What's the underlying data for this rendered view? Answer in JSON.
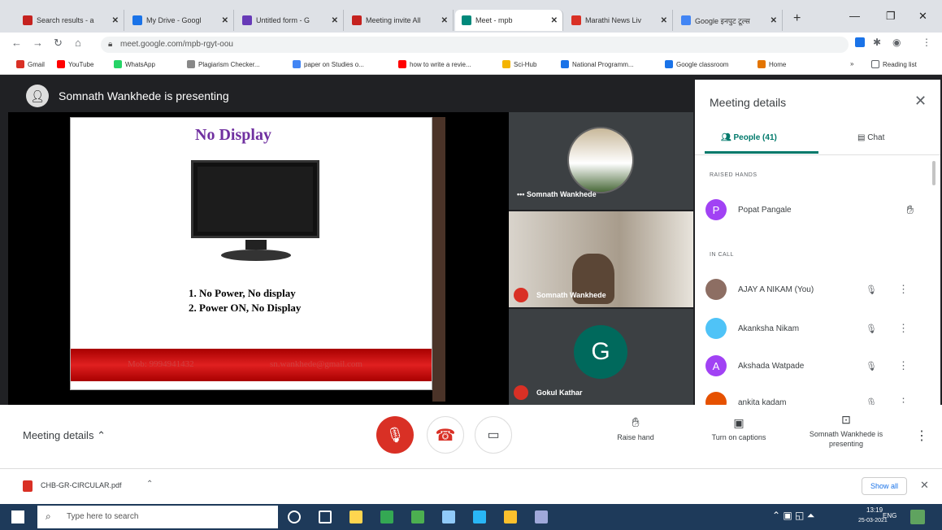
{
  "browser": {
    "tabs": [
      {
        "label": "Search results - a",
        "color": "#c5221f"
      },
      {
        "label": "My Drive - Googl",
        "color": "#1a73e8"
      },
      {
        "label": "Untitled form - G",
        "color": "#673ab7"
      },
      {
        "label": "Meeting invite All",
        "color": "#c5221f"
      },
      {
        "label": "Meet - mpb",
        "color": "#00897b"
      },
      {
        "label": "Marathi News Liv",
        "color": "#d93025"
      },
      {
        "label": "Google इनपुट टूल्स",
        "color": "#4285f4"
      }
    ],
    "url": "meet.google.com/mpb-rgyt-oou",
    "bookmarks": [
      {
        "label": "Gmail",
        "color": "#d93025"
      },
      {
        "label": "YouTube",
        "color": "#ff0000"
      },
      {
        "label": "WhatsApp",
        "color": "#25d366"
      },
      {
        "label": "Plagiarism Checker...",
        "color": "#888888"
      },
      {
        "label": "paper on Studies o...",
        "color": "#4285f4"
      },
      {
        "label": "how to write a revie...",
        "color": "#ff0000"
      },
      {
        "label": "Sci-Hub",
        "color": "#f4b400"
      },
      {
        "label": "National Programm...",
        "color": "#1a73e8"
      },
      {
        "label": "Google classroom",
        "color": "#1a73e8"
      },
      {
        "label": "Home",
        "color": "#e37400"
      }
    ],
    "reading_list": "Reading list"
  },
  "meet": {
    "presenting_banner": "Somnath Wankhede is presenting",
    "slide": {
      "title": "No Display",
      "items": [
        "1. No Power, No display",
        "2. Power ON, No Display"
      ],
      "footer_left": "Mob: 9994941432",
      "footer_right": "sn.wankhede@gmail.com"
    },
    "tiles": [
      {
        "name": "Somnath Wankhede"
      },
      {
        "name": "Somnath Wankhede"
      },
      {
        "name": "Gokul Kathar",
        "initial": "G"
      }
    ],
    "panel": {
      "title": "Meeting details",
      "tab_people": "People (41)",
      "tab_chat": "Chat",
      "raised_hands_heading": "RAISED HANDS",
      "raised": [
        {
          "name": "Popat Pangale",
          "initial": "P",
          "color": "#a142f4"
        }
      ],
      "in_call_heading": "IN CALL",
      "people": [
        {
          "name": "AJAY A NIKAM (You)",
          "color": "#8d6e63"
        },
        {
          "name": "Akanksha Nikam",
          "color": "#4fc3f7"
        },
        {
          "name": "Akshada Watpade",
          "initial": "A",
          "color": "#a142f4"
        },
        {
          "name": "ankita kadam",
          "color": "#e65100"
        }
      ]
    },
    "controls": {
      "meeting_details": "Meeting details",
      "raise_hand": "Raise hand",
      "captions": "Turn on captions",
      "presenting": "Somnath Wankhede is presenting"
    }
  },
  "downloads": {
    "file": "CHB-GR-CIRCULAR.pdf",
    "show_all": "Show all"
  },
  "taskbar": {
    "search_placeholder": "Type here to search",
    "lang": "ENG",
    "time": "13:19",
    "date": "25-03-2021"
  }
}
